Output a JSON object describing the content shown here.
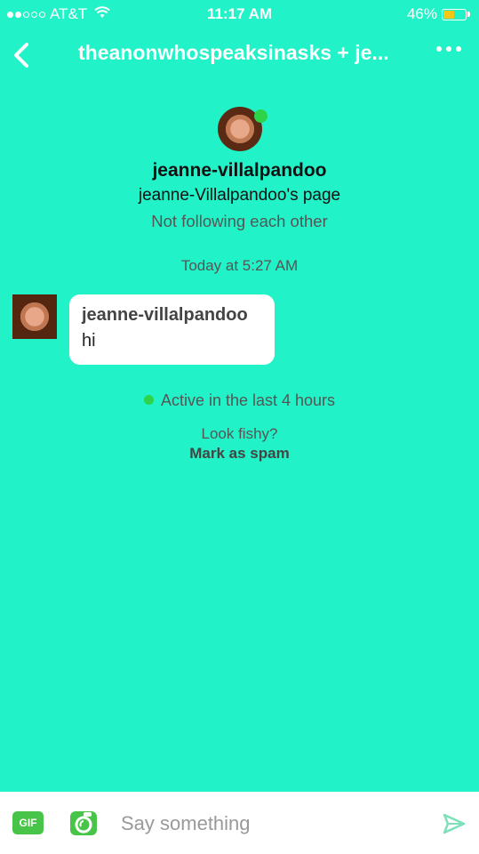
{
  "status_bar": {
    "carrier": "AT&T",
    "time": "11:17 AM",
    "battery": "46%",
    "battery_level": 0.46,
    "signal_bars": 2
  },
  "header": {
    "title": "theanonwhospeaksinasks + je..."
  },
  "profile": {
    "name": "jeanne-villalpandoo",
    "page": "jeanne-Villalpandoo's page",
    "follow_status": "Not following each other"
  },
  "conversation": {
    "timestamp": "Today at 5:27 AM",
    "messages": [
      {
        "sender": "jeanne-villalpandoo",
        "text": "hi"
      }
    ],
    "active_status": "Active in the last 4 hours",
    "fishy_prompt": "Look fishy?",
    "spam_label": "Mark as spam"
  },
  "composer": {
    "gif_label": "GIF",
    "placeholder": "Say something"
  },
  "colors": {
    "background": "#22f2c8",
    "online": "#2dd44a",
    "gif_green": "#48c548",
    "send_icon": "#7ee0b8"
  }
}
